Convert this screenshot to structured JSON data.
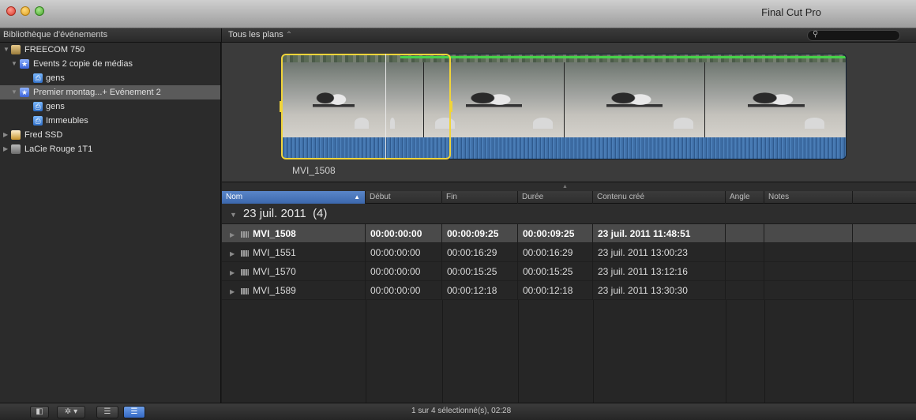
{
  "window": {
    "title": "Final Cut Pro"
  },
  "sidebar": {
    "header": "Bibliothèque d’événements",
    "items": [
      {
        "label": "FREECOM 750",
        "icon": "drive-icon"
      },
      {
        "label": "Events 2 copie de médias",
        "icon": "event-star-icon"
      },
      {
        "label": "gens",
        "icon": "keyword-collection-icon"
      },
      {
        "label": "Premier montag...+ Evénement 2",
        "icon": "event-star-icon"
      },
      {
        "label": "gens",
        "icon": "keyword-collection-icon"
      },
      {
        "label": "Immeubles",
        "icon": "keyword-collection-icon"
      },
      {
        "label": "Fred SSD",
        "icon": "home-drive-icon"
      },
      {
        "label": "LaCie Rouge 1T1",
        "icon": "external-drive-icon"
      }
    ]
  },
  "browser": {
    "filter_label": "Tous les plans",
    "filter_chevron": "⌃",
    "search_icon": "⚲",
    "clip_caption": "MVI_1508"
  },
  "list": {
    "columns": [
      "Nom",
      "Début",
      "Fin",
      "Durée",
      "Contenu créé",
      "Angle",
      "Notes"
    ],
    "sort_arrow": "▲",
    "group": {
      "label": "23 juil. 2011",
      "count": "(4)"
    },
    "rows": [
      {
        "name": "MVI_1508",
        "start": "00:00:00:00",
        "end": "00:00:09:25",
        "duration": "00:00:09:25",
        "created": "23 juil. 2011 11:48:51"
      },
      {
        "name": "MVI_1551",
        "start": "00:00:00:00",
        "end": "00:00:16:29",
        "duration": "00:00:16:29",
        "created": "23 juil. 2011 13:00:23"
      },
      {
        "name": "MVI_1570",
        "start": "00:00:00:00",
        "end": "00:00:15:25",
        "duration": "00:00:15:25",
        "created": "23 juil. 2011 13:12:16"
      },
      {
        "name": "MVI_1589",
        "start": "00:00:00:00",
        "end": "00:00:12:18",
        "duration": "00:00:12:18",
        "created": "23 juil. 2011 13:30:30"
      }
    ]
  },
  "statusbar": {
    "text": "1 sur 4 sélectionné(s), 02:28"
  },
  "colors": {
    "accent": "#3b67ad",
    "selection": "#f0d43a",
    "waveform": "#3e6ea6"
  }
}
